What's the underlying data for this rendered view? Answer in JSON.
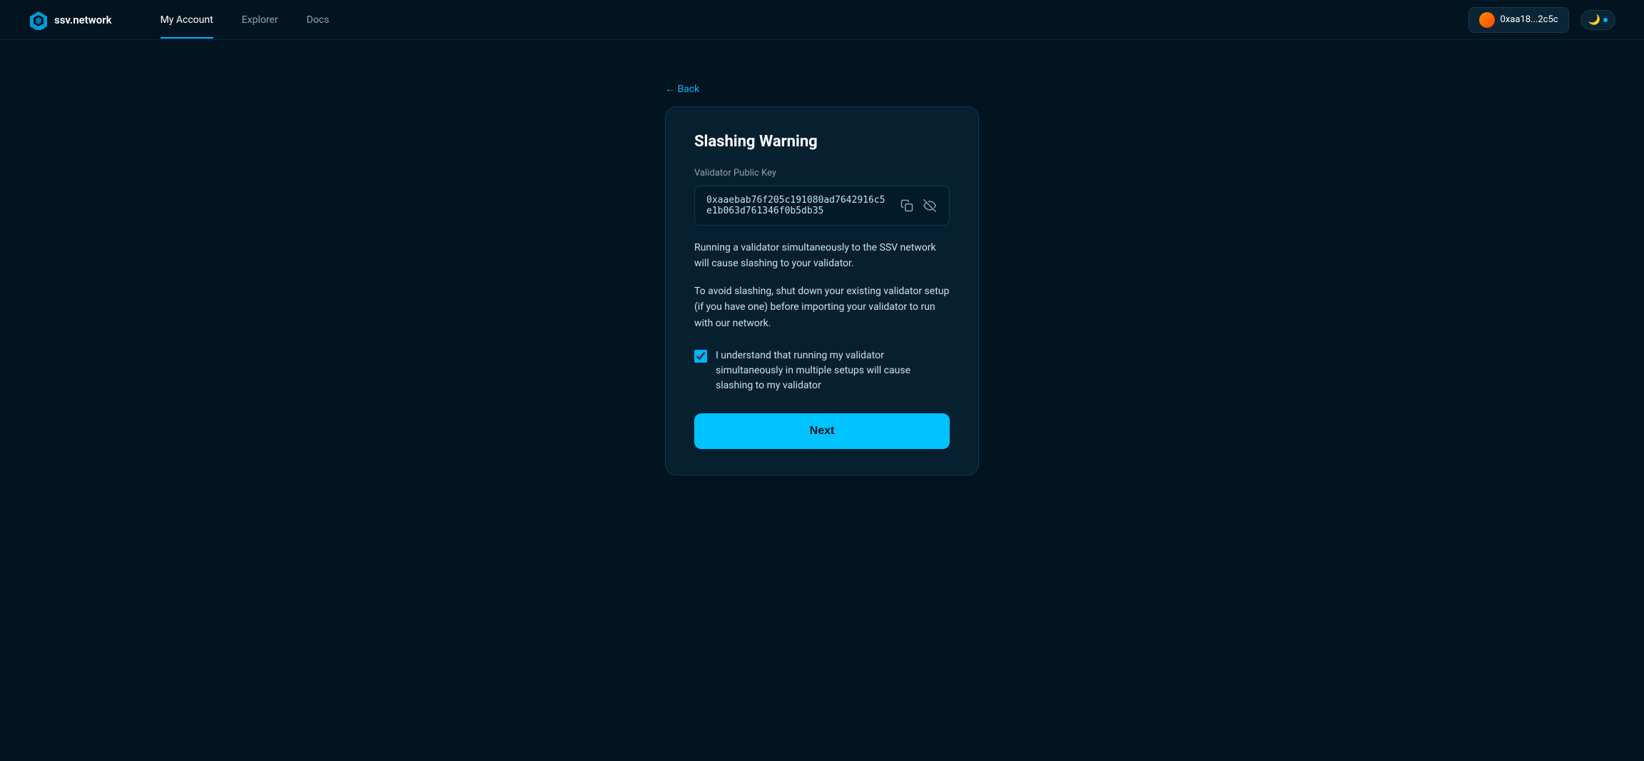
{
  "navbar": {
    "logo_text": "ssv.network",
    "links": [
      {
        "label": "My Account",
        "active": true
      },
      {
        "label": "Explorer",
        "active": false
      },
      {
        "label": "Docs",
        "active": false
      }
    ],
    "wallet_address": "0xaa18...2c5c",
    "theme_icon": "🌙"
  },
  "back_link": "← Back",
  "card": {
    "title": "Slashing Warning",
    "field_label": "Validator Public Key",
    "pubkey": "0xaaebab76f205c191080ad7642916c5e1b063d761346f0b5db35",
    "copy_icon": "copy",
    "view_icon": "eye-slash",
    "warning_1": "Running a validator simultaneously to the SSV network will cause slashing to your validator.",
    "warning_2": "To avoid slashing, shut down your existing validator setup (if you have one) before importing your validator to run with our network.",
    "checkbox_label": "I understand that running my validator simultaneously in multiple setups will cause slashing to my validator",
    "next_button": "Next"
  }
}
